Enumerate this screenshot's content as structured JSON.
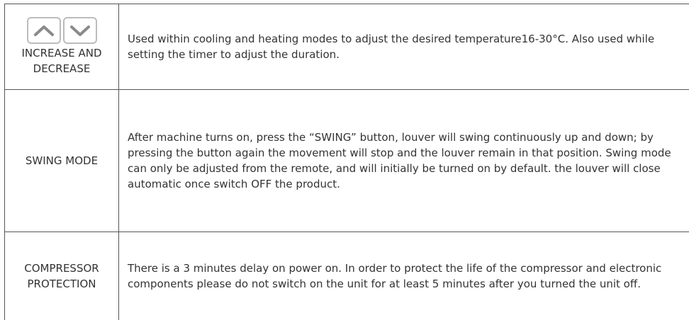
{
  "rows": [
    {
      "label": "INCREASE AND DECREASE",
      "description": "Used within cooling and heating modes to adjust the desired temperature16-30°C. Also used while setting the timer to adjust the duration.",
      "icons": [
        "chevron-up-icon",
        "chevron-down-icon"
      ]
    },
    {
      "label": "SWING MODE",
      "description": "After machine turns on, press the “SWING” button, louver will swing continuously up and down; by pressing the button again the movement will stop and the louver remain in that position. Swing mode can only be adjusted from the remote, and will initially be turned on by default. the louver will close automatic once switch OFF the product."
    },
    {
      "label": "COMPRESSOR PROTECTION",
      "description": "There is a 3 minutes delay on power on. In order to protect the life of the compressor and electronic components please do not switch on the unit for at least 5 minutes after you turned the unit off."
    }
  ],
  "colors": {
    "border": "#555555",
    "icon_stroke": "#bcbcbc",
    "text": "#333333"
  }
}
